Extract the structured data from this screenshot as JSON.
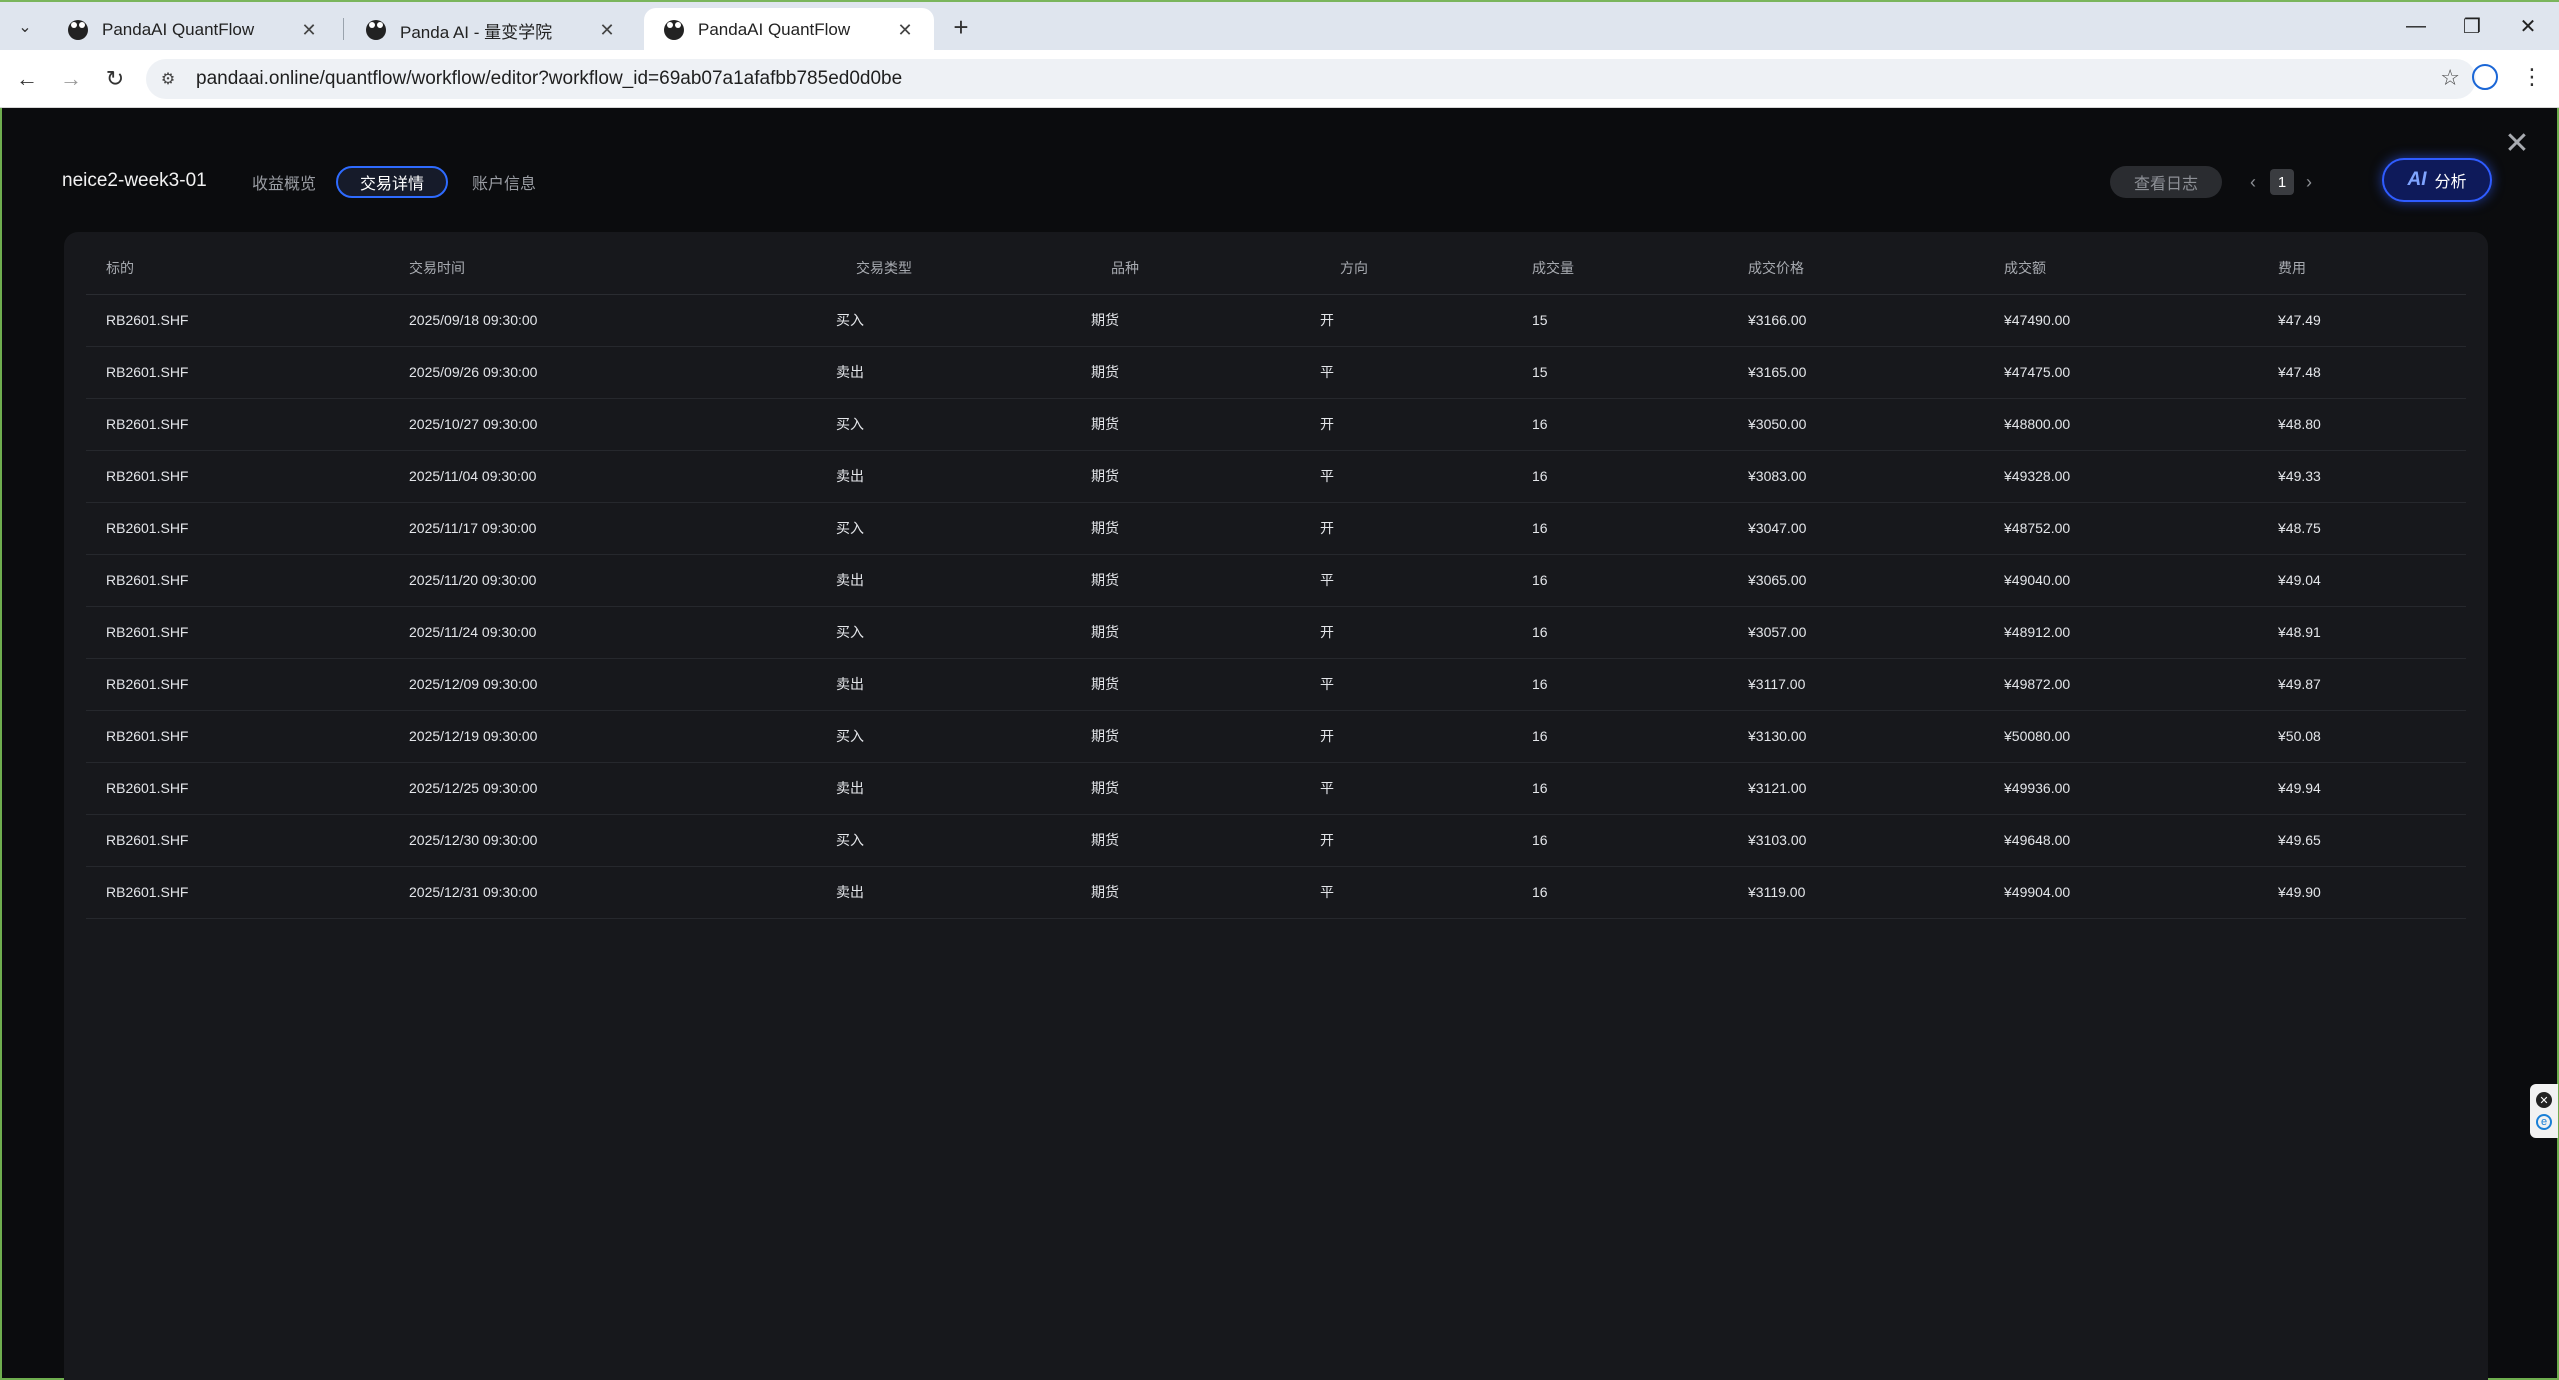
{
  "browser": {
    "tabs": [
      {
        "title": "PandaAI QuantFlow",
        "active": false
      },
      {
        "title": "Panda AI - 量变学院",
        "active": false
      },
      {
        "title": "PandaAI QuantFlow",
        "active": true
      }
    ],
    "tab_close_glyph": "✕",
    "new_tab_glyph": "+",
    "url": "pandaai.online/quantflow/workflow/editor?workflow_id=69ab07a1afafbb785ed0d0be",
    "window_controls": {
      "minimize": "—",
      "restore": "❐",
      "close": "✕"
    },
    "nav": {
      "back": "←",
      "forward": "→",
      "reload": "↻"
    }
  },
  "header": {
    "strategy_name": "neice2-week3-01",
    "tabs": [
      {
        "label": "收益概览",
        "active": false
      },
      {
        "label": "交易详情",
        "active": true
      },
      {
        "label": "账户信息",
        "active": false
      }
    ],
    "view_log_label": "查看日志",
    "pager": {
      "prev": "‹",
      "page": "1",
      "next": "›"
    },
    "ai_button": {
      "icon_text": "AI",
      "label": "分析"
    },
    "close_glyph": "✕"
  },
  "table": {
    "columns": [
      "标的",
      "交易时间",
      "交易类型",
      "品种",
      "方向",
      "成交量",
      "成交价格",
      "成交额",
      "费用"
    ],
    "rows": [
      {
        "symbol": "RB2601.SHF",
        "time": "2025/09/18 09:30:00",
        "type": "买入",
        "kind": "期货",
        "dir": "开",
        "qty": "15",
        "price": "¥3166.00",
        "amount": "¥47490.00",
        "fee": "¥47.49"
      },
      {
        "symbol": "RB2601.SHF",
        "time": "2025/09/26 09:30:00",
        "type": "卖出",
        "kind": "期货",
        "dir": "平",
        "qty": "15",
        "price": "¥3165.00",
        "amount": "¥47475.00",
        "fee": "¥47.48"
      },
      {
        "symbol": "RB2601.SHF",
        "time": "2025/10/27 09:30:00",
        "type": "买入",
        "kind": "期货",
        "dir": "开",
        "qty": "16",
        "price": "¥3050.00",
        "amount": "¥48800.00",
        "fee": "¥48.80"
      },
      {
        "symbol": "RB2601.SHF",
        "time": "2025/11/04 09:30:00",
        "type": "卖出",
        "kind": "期货",
        "dir": "平",
        "qty": "16",
        "price": "¥3083.00",
        "amount": "¥49328.00",
        "fee": "¥49.33"
      },
      {
        "symbol": "RB2601.SHF",
        "time": "2025/11/17 09:30:00",
        "type": "买入",
        "kind": "期货",
        "dir": "开",
        "qty": "16",
        "price": "¥3047.00",
        "amount": "¥48752.00",
        "fee": "¥48.75"
      },
      {
        "symbol": "RB2601.SHF",
        "time": "2025/11/20 09:30:00",
        "type": "卖出",
        "kind": "期货",
        "dir": "平",
        "qty": "16",
        "price": "¥3065.00",
        "amount": "¥49040.00",
        "fee": "¥49.04"
      },
      {
        "symbol": "RB2601.SHF",
        "time": "2025/11/24 09:30:00",
        "type": "买入",
        "kind": "期货",
        "dir": "开",
        "qty": "16",
        "price": "¥3057.00",
        "amount": "¥48912.00",
        "fee": "¥48.91"
      },
      {
        "symbol": "RB2601.SHF",
        "time": "2025/12/09 09:30:00",
        "type": "卖出",
        "kind": "期货",
        "dir": "平",
        "qty": "16",
        "price": "¥3117.00",
        "amount": "¥49872.00",
        "fee": "¥49.87"
      },
      {
        "symbol": "RB2601.SHF",
        "time": "2025/12/19 09:30:00",
        "type": "买入",
        "kind": "期货",
        "dir": "开",
        "qty": "16",
        "price": "¥3130.00",
        "amount": "¥50080.00",
        "fee": "¥50.08"
      },
      {
        "symbol": "RB2601.SHF",
        "time": "2025/12/25 09:30:00",
        "type": "卖出",
        "kind": "期货",
        "dir": "平",
        "qty": "16",
        "price": "¥3121.00",
        "amount": "¥49936.00",
        "fee": "¥49.94"
      },
      {
        "symbol": "RB2601.SHF",
        "time": "2025/12/30 09:30:00",
        "type": "买入",
        "kind": "期货",
        "dir": "开",
        "qty": "16",
        "price": "¥3103.00",
        "amount": "¥49648.00",
        "fee": "¥49.65"
      },
      {
        "symbol": "RB2601.SHF",
        "time": "2025/12/31 09:30:00",
        "type": "卖出",
        "kind": "期货",
        "dir": "平",
        "qty": "16",
        "price": "¥3119.00",
        "amount": "¥49904.00",
        "fee": "¥49.90"
      }
    ]
  },
  "colors": {
    "buy": "#e8455a",
    "sell": "#2ec27e",
    "accent": "#2e6bff"
  }
}
